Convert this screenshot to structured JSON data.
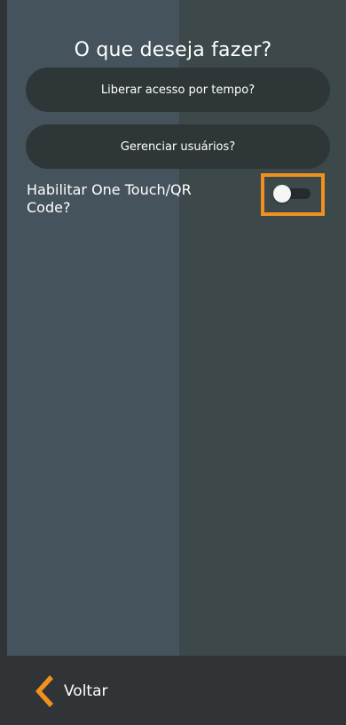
{
  "header": {
    "title": "O que deseja fazer?"
  },
  "actions": {
    "timed_access_label": "Liberar acesso por tempo?",
    "manage_users_label": "Gerenciar usuários?"
  },
  "settings": {
    "one_touch_label": "Habilitar One Touch/QR Code?",
    "one_touch_enabled": false
  },
  "footer": {
    "back_label": "Voltar"
  },
  "colors": {
    "accent": "#f0911f",
    "panel_left": "#45535d",
    "panel_right": "#3c4849",
    "button_bg": "#2f3638",
    "frame": "#303436"
  },
  "icons": {
    "back": "chevron-left-icon"
  }
}
